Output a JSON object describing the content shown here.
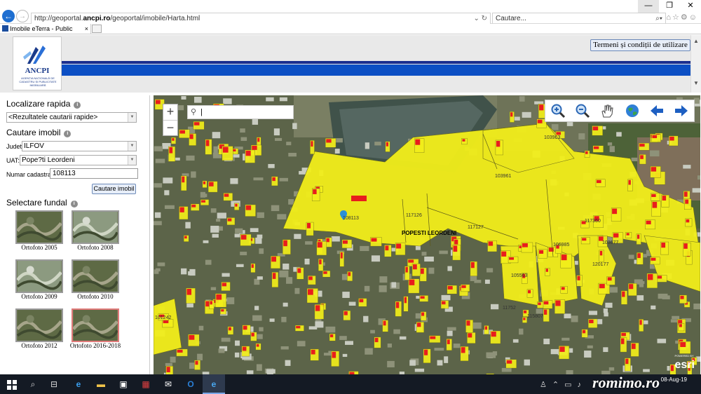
{
  "browser": {
    "url_prefix": "http://geoportal.",
    "url_domain": "ancpi.ro",
    "url_suffix": "/geoportal/imobile/Harta.html",
    "search_placeholder": "Cautare...",
    "tab_title": "Imobile eTerra - Public",
    "tab_close": "×",
    "window_minimize": "—",
    "window_restore": "❐",
    "window_close": "✕"
  },
  "header": {
    "logo_text": "ANCPI",
    "logo_subtext": "AGENȚIA NAȚIONALĂ DE CADASTRU ȘI PUBLICITATE IMOBILIARĂ",
    "terms_button": "Termeni și condiții de utilizare",
    "brand_blue": "#0c4fc4"
  },
  "left_panel": {
    "quick_search_title": "Localizare rapida",
    "quick_search_value": "<Rezultatele cautarii rapide>",
    "property_search_title": "Cautare imobil",
    "judet_label": "Judet:",
    "judet_value": "ILFOV",
    "uat_label": "UAT:",
    "uat_value": "Pope?ti Leordeni",
    "cadastral_label": "Numar cadastral:",
    "cadastral_value": "108113",
    "search_button": "Cautare imobil",
    "background_title": "Selectare fundal",
    "backgrounds": [
      {
        "label": "Ortofoto 2005",
        "selected": false
      },
      {
        "label": "Ortofoto 2008",
        "selected": false
      },
      {
        "label": "Ortofoto 2009",
        "selected": false
      },
      {
        "label": "Ortofoto 2010",
        "selected": false
      },
      {
        "label": "Ortofoto 2012",
        "selected": false
      },
      {
        "label": "Ortofoto 2016-2018",
        "selected": true
      }
    ]
  },
  "map": {
    "search_value": "|",
    "zoom_in": "+",
    "zoom_out": "−",
    "locality_label": "POPESTI LEORDENI",
    "parcel_labels": [
      {
        "id": "108113"
      },
      {
        "id": "117126"
      },
      {
        "id": "117127"
      },
      {
        "id": "103963"
      },
      {
        "id": "103961"
      },
      {
        "id": "117360"
      },
      {
        "id": "106985"
      },
      {
        "id": "103677"
      },
      {
        "id": "120177"
      },
      {
        "id": "105563"
      },
      {
        "id": "115807"
      },
      {
        "id": "101242"
      },
      {
        "id": "11752"
      }
    ],
    "tools": [
      "zoom-in-icon",
      "zoom-out-icon",
      "pan-hand-icon",
      "full-extent-globe-icon",
      "previous-extent-icon",
      "next-extent-icon"
    ],
    "attribution_small": "POWERED BY",
    "attribution": "esri",
    "parcel_color": "#f2ee1a",
    "building_color": "#e81d1d"
  },
  "taskbar": {
    "date": "08-Aug-19"
  },
  "watermark": "romimo.ro"
}
